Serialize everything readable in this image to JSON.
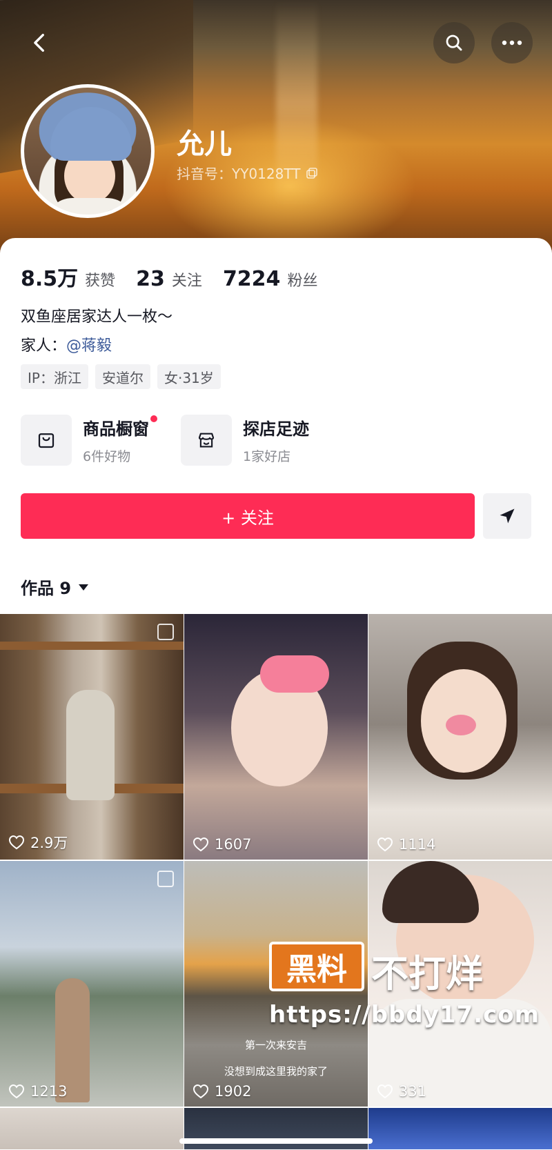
{
  "profile": {
    "name": "允儿",
    "douyin_id": "抖音号：YY0128TT",
    "bio": "双鱼座居家达人一枚～",
    "family_prefix": "家人：",
    "family_mention": "@蒋毅",
    "tags": [
      "IP：浙江",
      "安道尔",
      "女·31岁"
    ]
  },
  "stats": [
    {
      "value": "8.5万",
      "label": "获赞"
    },
    {
      "value": "23",
      "label": "关注"
    },
    {
      "value": "7224",
      "label": "粉丝"
    }
  ],
  "shops": [
    {
      "title": "商品橱窗",
      "subtitle": "6件好物",
      "icon": "shopping-bag-icon",
      "has_dot": true
    },
    {
      "title": "探店足迹",
      "subtitle": "1家好店",
      "icon": "store-icon",
      "has_dot": false
    }
  ],
  "actions": {
    "follow_label": "+ 关注"
  },
  "works": {
    "tab_label": "作品 9",
    "tiles": [
      {
        "likes": "2.9万",
        "pinned": true
      },
      {
        "likes": "1607",
        "pinned": false
      },
      {
        "likes": "1114",
        "pinned": false
      },
      {
        "likes": "1213",
        "pinned": true
      },
      {
        "likes": "1902",
        "pinned": false,
        "caption_line1": "第一次来安吉",
        "caption_line2": "没想到成这里我的家了"
      },
      {
        "likes": "331",
        "pinned": false
      }
    ]
  },
  "watermark": {
    "box_text": "黑料",
    "text": "不打烊",
    "url": "https://bbdy17.com"
  },
  "colors": {
    "accent": "#fe2c55",
    "mention": "#3c5a99",
    "watermark_orange": "#e3761d"
  }
}
